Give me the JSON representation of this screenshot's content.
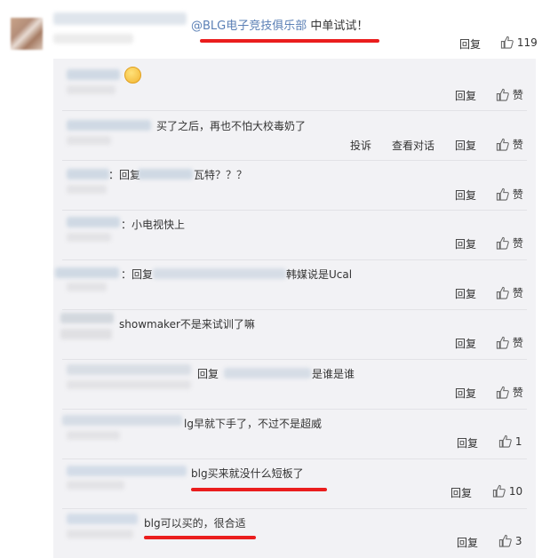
{
  "main_comment": {
    "mention": "@BLG电子竞技俱乐部",
    "text": "中单试试！",
    "reply_label": "回复",
    "like_count": "119"
  },
  "replies": [
    {
      "text": "",
      "actions": [
        "回复"
      ],
      "like": "赞",
      "has_emoji": true
    },
    {
      "text": "买了之后，再也不怕大校毒奶了",
      "actions": [
        "投诉",
        "查看对话",
        "回复"
      ],
      "like": "赞"
    },
    {
      "prefix": "：回复",
      "text": "瓦特？？？",
      "actions": [
        "回复"
      ],
      "like": "赞"
    },
    {
      "text": "：小电视快上",
      "actions": [
        "回复"
      ],
      "like": "赞"
    },
    {
      "prefix": "：回复",
      "text": "韩媒说是Ucal",
      "actions": [
        "回复"
      ],
      "like": "赞"
    },
    {
      "text": "showmaker不是来试训了嘛",
      "actions": [
        "回复"
      ],
      "like": "赞"
    },
    {
      "prefix": "回复",
      "text": "是谁是谁",
      "actions": [
        "回复"
      ],
      "like": "赞"
    },
    {
      "text": "lg早就下手了，不过不是超威",
      "actions": [
        "回复"
      ],
      "like": "1"
    },
    {
      "text": "blg买来就没什么短板了",
      "actions": [
        "回复"
      ],
      "like": "10"
    },
    {
      "text": "blg可以买的，很合适",
      "actions": [
        "回复"
      ],
      "like": "3"
    }
  ],
  "colors": {
    "accent": "#eb7350",
    "mention": "#5a7fb5",
    "underline": "#ea1d1d",
    "panel": "#f2f2f5"
  },
  "icons": {
    "like": "thumbs-up-icon",
    "emoji": "smile-emoji-icon"
  }
}
